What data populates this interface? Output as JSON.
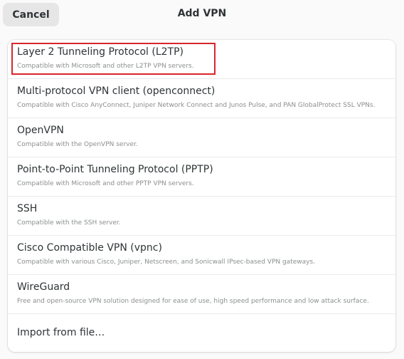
{
  "header": {
    "cancel_label": "Cancel",
    "title": "Add VPN"
  },
  "vpn_types": [
    {
      "title": "Layer 2 Tunneling Protocol (L2TP)",
      "subtitle": "Compatible with Microsoft and other L2TP VPN servers."
    },
    {
      "title": "Multi-protocol VPN client (openconnect)",
      "subtitle": "Compatible with Cisco AnyConnect, Juniper Network Connect and Junos Pulse, and PAN GlobalProtect SSL VPNs."
    },
    {
      "title": "OpenVPN",
      "subtitle": "Compatible with the OpenVPN server."
    },
    {
      "title": "Point-to-Point Tunneling Protocol (PPTP)",
      "subtitle": "Compatible with Microsoft and other PPTP VPN servers."
    },
    {
      "title": "SSH",
      "subtitle": "Compatible with the SSH server."
    },
    {
      "title": "Cisco Compatible VPN (vpnc)",
      "subtitle": "Compatible with various Cisco, Juniper, Netscreen, and Sonicwall IPsec-based VPN gateways."
    },
    {
      "title": "WireGuard",
      "subtitle": "Free and open-source VPN solution designed for ease of use, high speed performance and low attack surface."
    }
  ],
  "import_label": "Import from file…",
  "colors": {
    "highlight": "#d9252b",
    "background": "#fafafa",
    "list_background": "#ffffff",
    "subtitle": "#8b8e8f"
  }
}
